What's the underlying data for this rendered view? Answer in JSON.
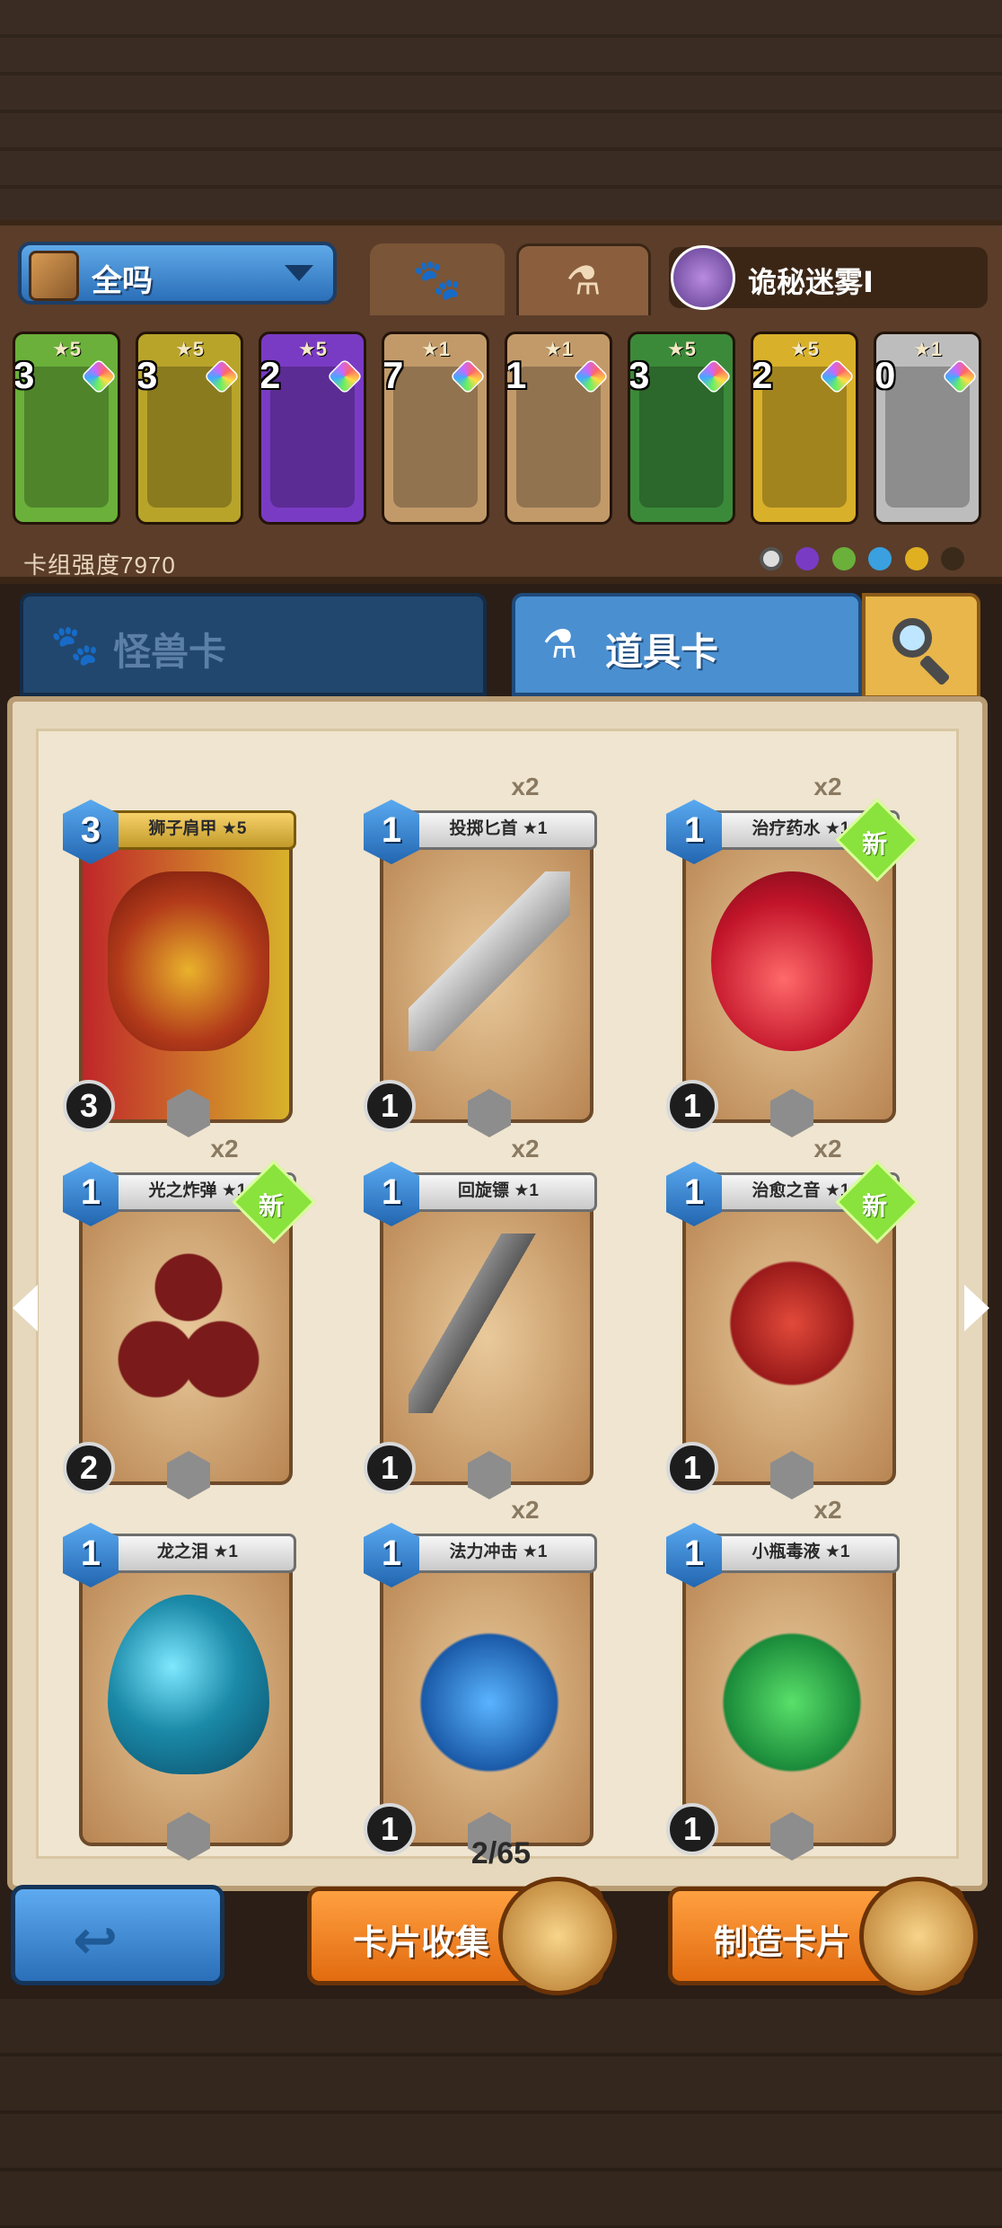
{
  "deck": {
    "name": "全吗",
    "hero_name": "诡秘迷雾Ⅰ",
    "strength_label": "卡组强度7970",
    "cards": [
      {
        "stars": "★5",
        "count": "3",
        "color": "#6ab03a"
      },
      {
        "stars": "★5",
        "count": "3",
        "color": "#b9a42a"
      },
      {
        "stars": "★5",
        "count": "2",
        "color": "#7a3bc4"
      },
      {
        "stars": "★1",
        "count": "7",
        "color": "#c29a6a"
      },
      {
        "stars": "★1",
        "count": "1",
        "color": "#c29a6a"
      },
      {
        "stars": "★5",
        "count": "3",
        "color": "#3b8a3a"
      },
      {
        "stars": "★5",
        "count": "2",
        "color": "#d9b02a"
      },
      {
        "stars": "★1",
        "count": "0",
        "color": "#bdbdbd"
      }
    ]
  },
  "categories": {
    "monster": "怪兽卡",
    "item": "道具卡"
  },
  "cards": [
    {
      "name": "狮子肩甲 ★5",
      "cost": "3",
      "attack": "3",
      "copies": "",
      "is_new": "",
      "art": "armor"
    },
    {
      "name": "投掷匕首 ★1",
      "cost": "1",
      "attack": "1",
      "copies": "x2",
      "is_new": "",
      "art": "dagger"
    },
    {
      "name": "治疗药水 ★1",
      "cost": "1",
      "attack": "1",
      "copies": "x2",
      "is_new": "新",
      "art": "potion"
    },
    {
      "name": "光之炸弹 ★1",
      "cost": "1",
      "attack": "2",
      "copies": "x2",
      "is_new": "新",
      "art": "bombs"
    },
    {
      "name": "回旋镖 ★1",
      "cost": "1",
      "attack": "1",
      "copies": "x2",
      "is_new": "",
      "art": "boomerang"
    },
    {
      "name": "治愈之音 ★1",
      "cost": "1",
      "attack": "1",
      "copies": "x2",
      "is_new": "新",
      "art": "harp"
    },
    {
      "name": "龙之泪 ★1",
      "cost": "1",
      "attack": "",
      "copies": "",
      "is_new": "",
      "art": "egg"
    },
    {
      "name": "法力冲击 ★1",
      "cost": "1",
      "attack": "1",
      "copies": "x2",
      "is_new": "",
      "art": "mana"
    },
    {
      "name": "小瓶毒液 ★1",
      "cost": "1",
      "attack": "1",
      "copies": "x2",
      "is_new": "",
      "art": "poison"
    }
  ],
  "pagination": "2/65",
  "buttons": {
    "back": "↩",
    "collect": "卡片收集",
    "craft": "制造卡片"
  },
  "colors": {
    "accent_blue": "#4a8fd0",
    "button_orange": "#f08020",
    "new_badge": "#8ae23c"
  }
}
